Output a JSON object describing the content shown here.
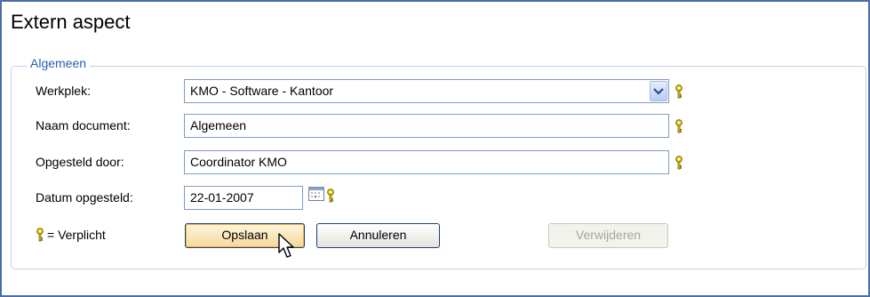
{
  "page": {
    "title": "Extern aspect"
  },
  "section": {
    "legend": "Algemeen"
  },
  "form": {
    "workplace": {
      "label": "Werkplek:",
      "value": "KMO - Software - Kantoor"
    },
    "document_name": {
      "label": "Naam document:",
      "value": "Algemeen"
    },
    "drafted_by": {
      "label": "Opgesteld door:",
      "value": "Coordinator KMO"
    },
    "date_drafted": {
      "label": "Datum opgesteld:",
      "value": "22-01-2007"
    }
  },
  "required_note": "= Verplicht",
  "buttons": {
    "save": "Opslaan",
    "cancel": "Annuleren",
    "delete": "Verwijderen"
  },
  "icons": {
    "required": "key-icon",
    "calendar": "calendar-icon",
    "dropdown": "chevron-down-icon",
    "cursor": "mouse-pointer-icon"
  },
  "colors": {
    "legend_text": "#2a5db0",
    "frame_border": "#4a6fa5",
    "key_icon": "#e8c800"
  }
}
